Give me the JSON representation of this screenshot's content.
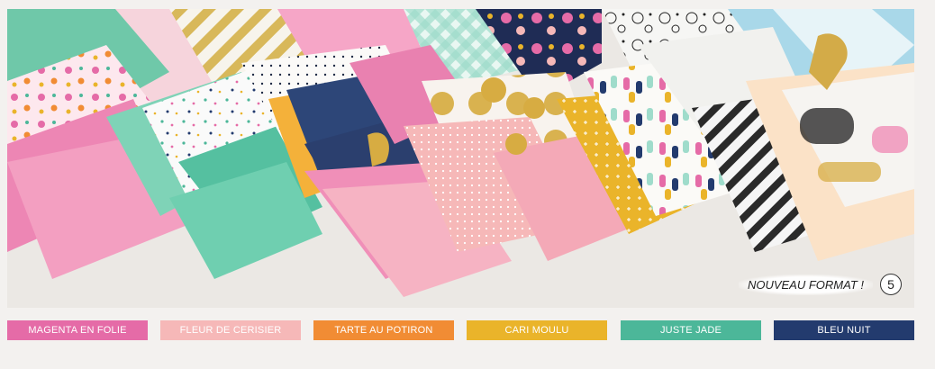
{
  "badge": {
    "text": "NOUVEAU FORMAT !",
    "number": "5"
  },
  "swatches": [
    {
      "label": "MAGENTA EN FOLIE",
      "color": "#e56ba7"
    },
    {
      "label": "FLEUR DE CERISIER",
      "color": "#f6b8b8"
    },
    {
      "label": "TARTE AU POTIRON",
      "color": "#f18c34"
    },
    {
      "label": "CARI MOULU",
      "color": "#eab42a"
    },
    {
      "label": "JUSTE JADE",
      "color": "#4cb799"
    },
    {
      "label": "BLEU NUIT",
      "color": "#233b6e"
    }
  ]
}
